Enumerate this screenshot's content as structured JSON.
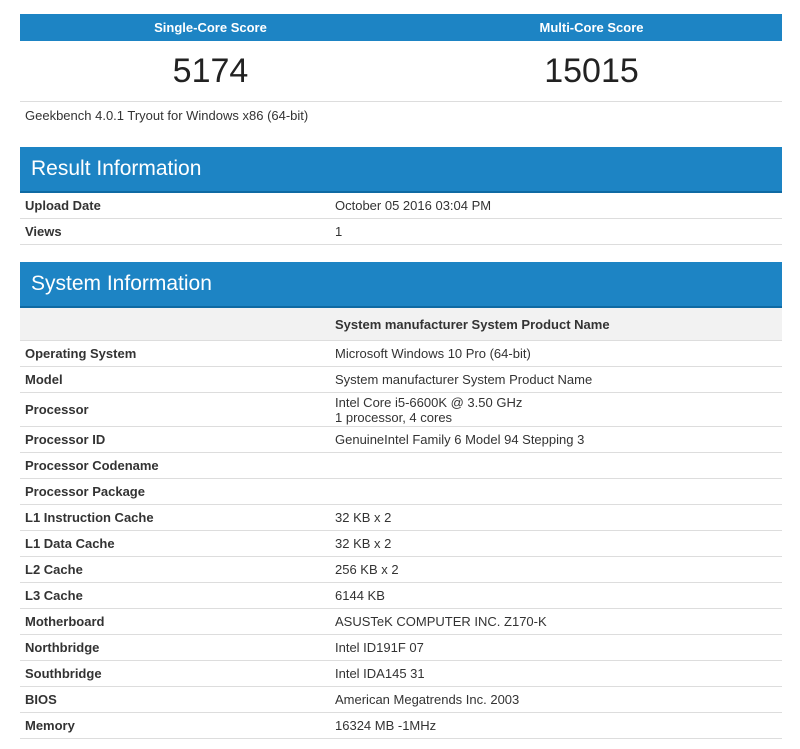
{
  "scores": {
    "single_label": "Single-Core Score",
    "multi_label": "Multi-Core Score",
    "single_value": "5174",
    "multi_value": "15015"
  },
  "benchmark": "Geekbench 4.0.1 Tryout for Windows x86 (64-bit)",
  "result_info": {
    "title": "Result Information",
    "rows": [
      {
        "key": "Upload Date",
        "value": "October 05 2016 03:04 PM"
      },
      {
        "key": "Views",
        "value": "1"
      }
    ]
  },
  "system_info": {
    "title": "System Information",
    "subheader": "System manufacturer System Product Name",
    "rows": [
      {
        "key": "Operating System",
        "value": "Microsoft Windows 10 Pro (64-bit)"
      },
      {
        "key": "Model",
        "value": "System manufacturer System Product Name"
      },
      {
        "key": "Processor",
        "value": "Intel Core i5-6600K @ 3.50 GHz",
        "value2": "1 processor, 4 cores"
      },
      {
        "key": "Processor ID",
        "value": "GenuineIntel Family 6 Model 94 Stepping 3"
      },
      {
        "key": "Processor Codename",
        "value": ""
      },
      {
        "key": "Processor Package",
        "value": ""
      },
      {
        "key": "L1 Instruction Cache",
        "value": "32 KB x 2"
      },
      {
        "key": "L1 Data Cache",
        "value": "32 KB x 2"
      },
      {
        "key": "L2 Cache",
        "value": "256 KB x 2"
      },
      {
        "key": "L3 Cache",
        "value": "6144 KB"
      },
      {
        "key": "Motherboard",
        "value": "ASUSTeK COMPUTER INC. Z170-K"
      },
      {
        "key": "Northbridge",
        "value": "Intel ID191F 07"
      },
      {
        "key": "Southbridge",
        "value": "Intel IDA145 31"
      },
      {
        "key": "BIOS",
        "value": "American Megatrends Inc. 2003"
      },
      {
        "key": "Memory",
        "value": "16324 MB -1MHz"
      }
    ]
  },
  "colors": {
    "accent": "#1d84c4",
    "row_border": "#dddddd",
    "subheader_bg": "#f2f2f2"
  }
}
